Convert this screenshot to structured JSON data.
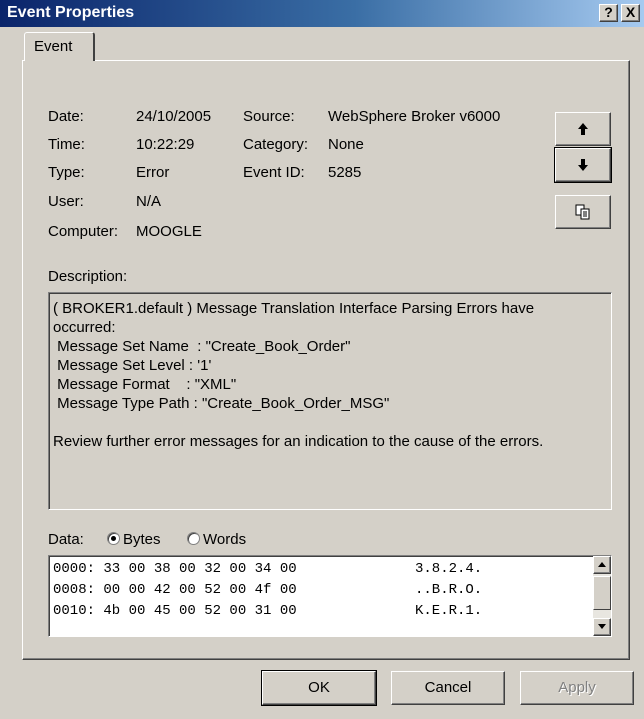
{
  "window": {
    "title": "Event Properties",
    "help_label": "?",
    "close_label": "X"
  },
  "tab": {
    "label": "Event"
  },
  "fields": {
    "date_label": "Date:",
    "date_value": "24/10/2005",
    "source_label": "Source:",
    "source_value": "WebSphere Broker v6000",
    "time_label": "Time:",
    "time_value": "10:22:29",
    "category_label": "Category:",
    "category_value": "None",
    "type_label": "Type:",
    "type_value": "Error",
    "eventid_label": "Event ID:",
    "eventid_value": "5285",
    "user_label": "User:",
    "user_value": "N/A",
    "computer_label": "Computer:",
    "computer_value": "MOOGLE"
  },
  "side_buttons": {
    "up_icon": "up-arrow-icon",
    "down_icon": "down-arrow-icon",
    "copy_icon": "copy-icon"
  },
  "description": {
    "label": "Description:",
    "lines": [
      "( BROKER1.default ) Message Translation Interface Parsing Errors have",
      "occurred:",
      " Message Set Name  : \"Create_Book_Order\"",
      " Message Set Level : '1'",
      " Message Format    : \"XML\"",
      " Message Type Path : \"Create_Book_Order_MSG\"",
      "",
      "Review further error messages for an indication to the cause of the errors."
    ]
  },
  "data": {
    "label": "Data:",
    "bytes_label": "Bytes",
    "words_label": "Words",
    "selected": "Bytes",
    "rows": [
      {
        "hex": "0000: 33 00 38 00 32 00 34 00",
        "ascii": "3.8.2.4."
      },
      {
        "hex": "0008: 00 00 42 00 52 00 4f 00",
        "ascii": "..B.R.O."
      },
      {
        "hex": "0010: 4b 00 45 00 52 00 31 00",
        "ascii": "K.E.R.1."
      }
    ]
  },
  "buttons": {
    "ok": "OK",
    "cancel": "Cancel",
    "apply": "Apply"
  }
}
